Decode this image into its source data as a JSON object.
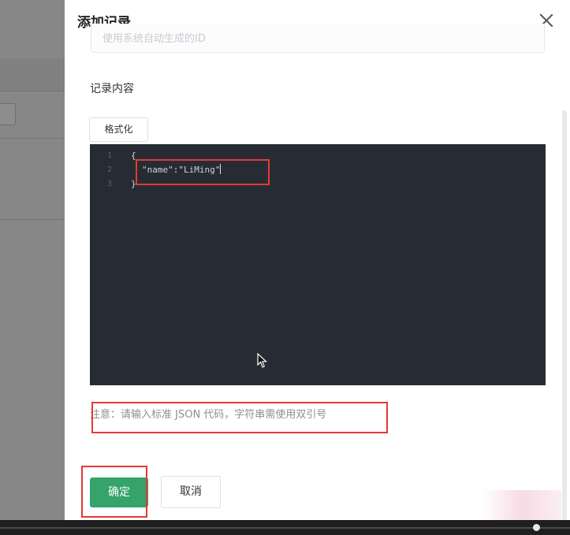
{
  "modal": {
    "title": "添加记录",
    "top_input_placeholder": "使用系统自动生成的ID",
    "content_label": "记录内容",
    "format_button": "格式化",
    "editor": {
      "line_numbers": [
        "1",
        "2",
        "3"
      ],
      "open_brace": "{",
      "json_key": "\"name\"",
      "colon": ":",
      "json_value": "\"LiMing\"",
      "close_brace": "}"
    },
    "note": "注意：请输入标准 JSON 代码，字符串需使用双引号",
    "confirm_button": "确定",
    "cancel_button": "取消"
  },
  "colors": {
    "primary": "#35a36a",
    "editor_bg": "#272c34",
    "highlight": "#e53935"
  },
  "icons": [
    "close-icon",
    "mouse-cursor-icon"
  ]
}
